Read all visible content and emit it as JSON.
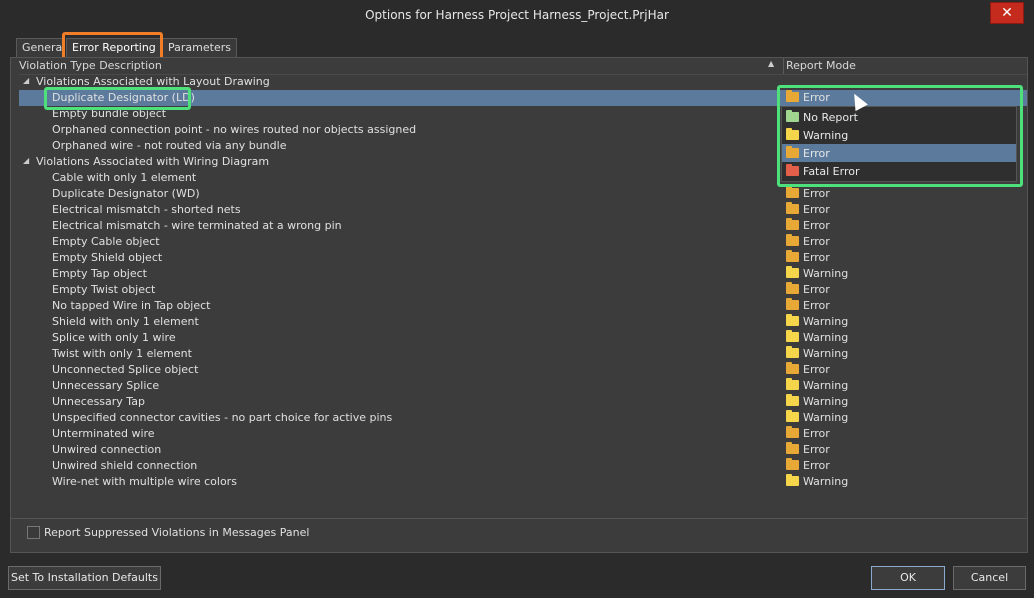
{
  "window": {
    "title": "Options for Harness Project Harness_Project.PrjHar",
    "close_glyph": "✕"
  },
  "tabs": [
    {
      "label": "General"
    },
    {
      "label": "Error Reporting"
    },
    {
      "label": "Parameters"
    }
  ],
  "table": {
    "col_description": "Violation Type Description",
    "col_mode": "Report Mode",
    "sort_glyph": "▲",
    "rows": [
      {
        "kind": "group",
        "desc": "Violations Associated with Layout Drawing"
      },
      {
        "kind": "item",
        "desc": "Duplicate Designator (LD)",
        "mode": "Error",
        "selected": true
      },
      {
        "kind": "item",
        "desc": "Empty bundle object",
        "mode": ""
      },
      {
        "kind": "item",
        "desc": "Orphaned connection point - no wires routed nor objects assigned",
        "mode": ""
      },
      {
        "kind": "item",
        "desc": "Orphaned wire - not routed via any bundle",
        "mode": ""
      },
      {
        "kind": "group",
        "desc": "Violations Associated with Wiring Diagram"
      },
      {
        "kind": "item",
        "desc": "Cable with only 1 element",
        "mode": ""
      },
      {
        "kind": "item",
        "desc": "Duplicate Designator (WD)",
        "mode": "Error"
      },
      {
        "kind": "item",
        "desc": "Electrical mismatch - shorted nets",
        "mode": "Error"
      },
      {
        "kind": "item",
        "desc": "Electrical mismatch - wire terminated at a wrong pin",
        "mode": "Error"
      },
      {
        "kind": "item",
        "desc": "Empty Cable object",
        "mode": "Error"
      },
      {
        "kind": "item",
        "desc": "Empty Shield object",
        "mode": "Error"
      },
      {
        "kind": "item",
        "desc": "Empty Tap object",
        "mode": "Warning"
      },
      {
        "kind": "item",
        "desc": "Empty Twist object",
        "mode": "Error"
      },
      {
        "kind": "item",
        "desc": "No tapped Wire in Tap object",
        "mode": "Error"
      },
      {
        "kind": "item",
        "desc": "Shield with only 1 element",
        "mode": "Warning"
      },
      {
        "kind": "item",
        "desc": "Splice with only 1 wire",
        "mode": "Warning"
      },
      {
        "kind": "item",
        "desc": "Twist with only 1 element",
        "mode": "Warning"
      },
      {
        "kind": "item",
        "desc": "Unconnected Splice object",
        "mode": "Error"
      },
      {
        "kind": "item",
        "desc": "Unnecessary Splice",
        "mode": "Warning"
      },
      {
        "kind": "item",
        "desc": "Unnecessary Tap",
        "mode": "Warning"
      },
      {
        "kind": "item",
        "desc": "Unspecified connector cavities - no part choice for active pins",
        "mode": "Warning"
      },
      {
        "kind": "item",
        "desc": "Unterminated wire",
        "mode": "Error"
      },
      {
        "kind": "item",
        "desc": "Unwired connection",
        "mode": "Error"
      },
      {
        "kind": "item",
        "desc": "Unwired shield connection",
        "mode": "Error"
      },
      {
        "kind": "item",
        "desc": "Wire-net with multiple wire colors",
        "mode": "Warning"
      }
    ]
  },
  "dropdown": {
    "options": [
      {
        "label": "No Report",
        "icon": "folder-green-icon"
      },
      {
        "label": "Warning",
        "icon": "folder-yellow-icon"
      },
      {
        "label": "Error",
        "icon": "folder-orange-icon",
        "selected": true
      },
      {
        "label": "Fatal Error",
        "icon": "folder-red-icon"
      }
    ]
  },
  "footer": {
    "checkbox_label": "Report Suppressed Violations in Messages Panel",
    "checkbox_checked": false,
    "defaults_button": "Set To Installation Defaults",
    "ok_button": "OK",
    "cancel_button": "Cancel"
  },
  "colors": {
    "error": "#e8a835",
    "warning": "#f5d64a",
    "no_report": "#9fd58e",
    "fatal": "#e45f4a",
    "selection": "#5c7a9b",
    "highlight_green": "#4ee07a",
    "highlight_orange": "#f07d28"
  }
}
